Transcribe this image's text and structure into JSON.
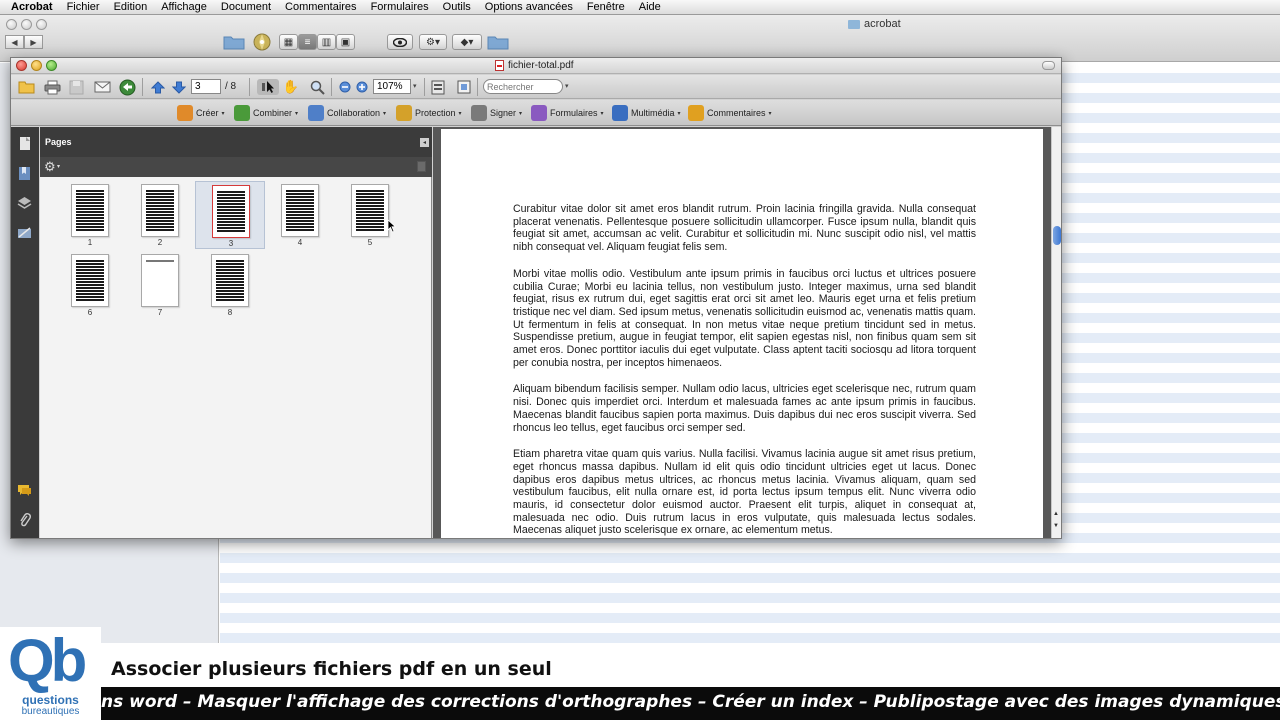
{
  "menubar": {
    "app_name": "Acrobat",
    "items": [
      "Fichier",
      "Edition",
      "Affichage",
      "Document",
      "Commentaires",
      "Formulaires",
      "Outils",
      "Options avancées",
      "Fenêtre",
      "Aide"
    ]
  },
  "finder": {
    "title": "acrobat",
    "nav_back": "◀",
    "nav_forward": "▶"
  },
  "acrobat": {
    "window_title": "fichier-total.pdf",
    "toolbar": {
      "current_page": "3",
      "page_total": "/ 8",
      "zoom": "107%",
      "search_placeholder": "Rechercher"
    },
    "tasks": [
      {
        "label": "Créer",
        "color": "#e08a2a"
      },
      {
        "label": "Combiner",
        "color": "#4a9a3a"
      },
      {
        "label": "Collaboration",
        "color": "#4f7fc8"
      },
      {
        "label": "Protection",
        "color": "#d4a12a"
      },
      {
        "label": "Signer",
        "color": "#7a7a7a"
      },
      {
        "label": "Formulaires",
        "color": "#8a5ac0"
      },
      {
        "label": "Multimédia",
        "color": "#3a6ec0"
      },
      {
        "label": "Commentaires",
        "color": "#e0a020"
      }
    ],
    "pages_panel": {
      "title": "Pages",
      "thumbnails": [
        "1",
        "2",
        "3",
        "4",
        "5",
        "6",
        "7",
        "8"
      ],
      "selected_page": "3"
    },
    "document": {
      "paragraphs": [
        "Curabitur vitae dolor sit amet eros blandit rutrum. Proin lacinia fringilla gravida. Nulla consequat placerat venenatis. Pellentesque posuere sollicitudin ullamcorper. Fusce ipsum nulla, blandit quis feugiat sit amet, accumsan ac velit. Curabitur et sollicitudin mi. Nunc suscipit odio nisl, vel mattis nibh consequat vel. Aliquam feugiat felis sem.",
        "Morbi vitae mollis odio. Vestibulum ante ipsum primis in faucibus orci luctus et ultrices posuere cubilia Curae; Morbi eu lacinia tellus, non vestibulum justo. Integer maximus, urna sed blandit feugiat, risus ex rutrum dui, eget sagittis erat orci sit amet leo. Mauris eget urna et felis pretium tristique nec vel diam. Sed ipsum metus, venenatis sollicitudin euismod ac, venenatis mattis quam. Ut fermentum in felis at consequat. In non metus vitae neque pretium tincidunt sed in metus. Suspendisse pretium, augue in feugiat tempor, elit sapien egestas nisl, non finibus quam sem sit amet eros. Donec porttitor iaculis dui eget vulputate. Class aptent taciti sociosqu ad litora torquent per conubia nostra, per inceptos himenaeos.",
        "Aliquam bibendum facilisis semper. Nullam odio lacus, ultricies eget scelerisque nec, rutrum quam nisi. Donec quis imperdiet orci. Interdum et malesuada fames ac ante ipsum primis in faucibus. Maecenas blandit faucibus sapien porta maximus. Duis dapibus dui nec eros suscipit viverra. Sed rhoncus leo tellus, eget faucibus orci semper sed.",
        "Etiam pharetra vitae quam quis varius. Nulla facilisi. Vivamus lacinia augue sit amet risus pretium, eget rhoncus massa dapibus. Nullam id elit quis odio tincidunt ultricies eget ut lacus. Donec dapibus eros dapibus metus ultrices, ac rhoncus metus lacinia. Vivamus aliquam, quam sed vestibulum faucibus, elit nulla ornare est, id porta lectus ipsum tempus elit. Nunc viverra odio mauris, id consectetur dolor euismod auctor. Praesent elit turpis, aliquet in consequat at, malesuada nec odio. Duis rutrum lacus in eros vulputate, quis malesuada lectus sodales. Maecenas aliquet justo scelerisque ex ornare, ac elementum metus."
      ]
    }
  },
  "overlay": {
    "logo_letters": "Qb",
    "logo_line1": "questions",
    "logo_line2": "bureautiques",
    "title": "Associer plusieurs fichiers pdf en un seul",
    "ticker": "ns word – Masquer l'affichage des corrections d'orthographes – Créer un index – Publipostage avec des images dynamiques – Masq"
  },
  "colors": {
    "logo_blue": "#2f71b5",
    "ticker_bg": "#0b0b0b",
    "selected_thumb_border": "#d53a3a"
  }
}
